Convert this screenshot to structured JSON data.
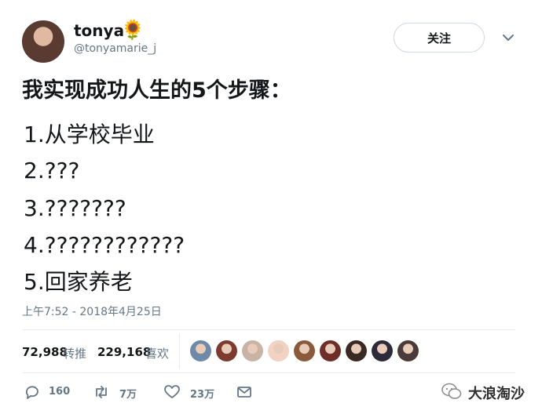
{
  "tweet": {
    "display_name": "tonya",
    "name_emoji": "🌻",
    "handle": "@tonyamarie_j",
    "follow_label": "关注",
    "headline": "我实现成功人生的5个步骤：",
    "steps": [
      "1.从学校毕业",
      "2.???",
      "3.???????",
      "4.????????????",
      "5.回家养老"
    ],
    "timestamp": "上午7:52 - 2018年4月25日"
  },
  "stats": {
    "retweets_count": "72,988",
    "retweets_label": "转推",
    "likes_count": "229,168",
    "likes_label": "喜欢"
  },
  "likers": {
    "avatar_colors": [
      "#6f8aa6",
      "#7b3b2e",
      "#c9b3a4",
      "#f1d2c3",
      "#8a5a3c",
      "#6e2f2a",
      "#3a2a24",
      "#2d2b3a",
      "#4a3a3a"
    ]
  },
  "actions": {
    "reply_count": "160",
    "retweet_count": "7万",
    "like_count": "23万"
  },
  "watermark": {
    "text": "大浪淘沙"
  },
  "colors": {
    "text_primary": "#14171a",
    "text_secondary": "#657786",
    "divider": "#e6ecf0"
  }
}
